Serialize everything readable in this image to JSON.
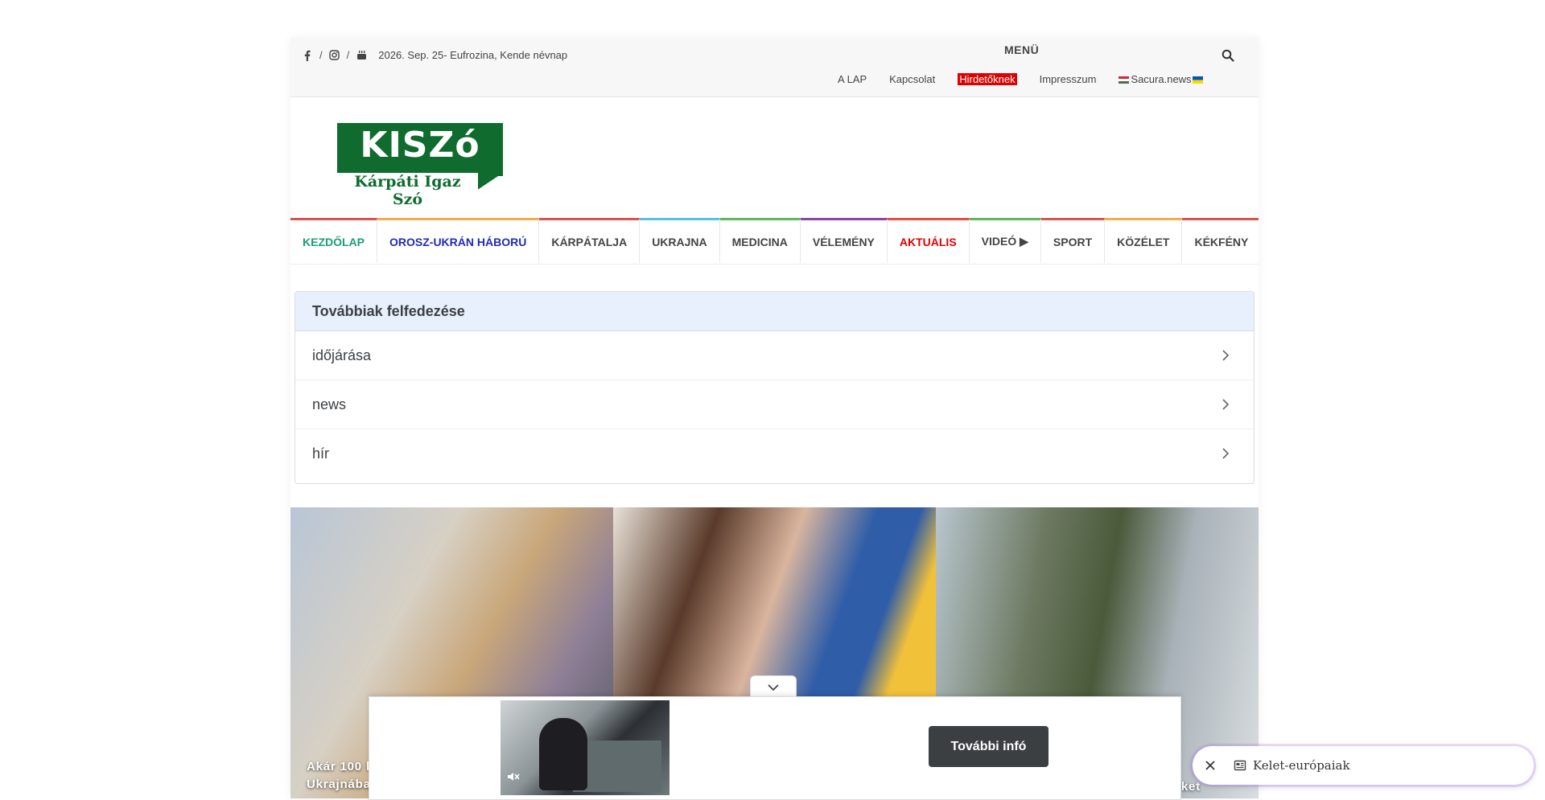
{
  "topbar": {
    "date": "2026. Sep. 25- Eufrozina, Kende névnap",
    "menu_label": "MENÜ",
    "social_separator": "/",
    "links": {
      "a_lap": "A LAP",
      "kapcsolat": "Kapcsolat",
      "hirdetoknek": "Hirdetőknek",
      "impresszum": "Impresszum",
      "sacura": "Sacura.news"
    }
  },
  "logo": {
    "title": "KISZó",
    "subtitle": "Kárpáti Igaz Szó"
  },
  "nav": {
    "items": [
      {
        "label": "KEZDŐLAP",
        "color": "#1a9c7a",
        "border": "#d9534f"
      },
      {
        "label": "OROSZ-UKRÁN HÁBORÚ",
        "color": "#1f2bb5",
        "border": "#f0ad4e"
      },
      {
        "label": "KÁRPÁTALJA",
        "color": "#444444",
        "border": "#d9534f"
      },
      {
        "label": "UKRAJNA",
        "color": "#444444",
        "border": "#5bc0de"
      },
      {
        "label": "MEDICINA",
        "color": "#444444",
        "border": "#5cb85c"
      },
      {
        "label": "VÉLEMÉNY",
        "color": "#444444",
        "border": "#8e44ad"
      },
      {
        "label": "AKTUÁLIS",
        "color": "#e00000",
        "border": "#e74c3c"
      },
      {
        "label": "VIDEÓ ▶",
        "color": "#444444",
        "border": "#5cb85c"
      },
      {
        "label": "SPORT",
        "color": "#444444",
        "border": "#d9534f"
      },
      {
        "label": "KÖZÉLET",
        "color": "#444444",
        "border": "#f0ad4e"
      },
      {
        "label": "KÉKFÉNY",
        "color": "#444444",
        "border": "#d9534f"
      }
    ]
  },
  "discover": {
    "heading": "Továbbiak felfedezése",
    "items": [
      "időjárása",
      "news",
      "hír"
    ]
  },
  "hero": {
    "caption_left_1": "Akár 100 h",
    "caption_left_2": "Ukrajnába",
    "caption_right": "ket"
  },
  "ad": {
    "cta": "További infó"
  },
  "chip": {
    "label": "Kelet-európaiak"
  }
}
